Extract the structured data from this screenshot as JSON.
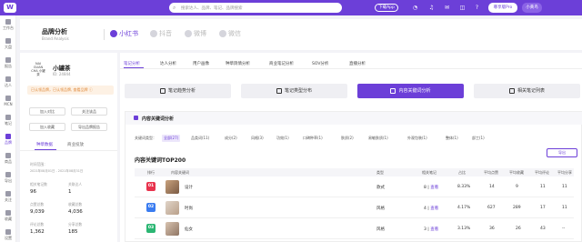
{
  "topbar": {
    "logo": "W",
    "search_placeholder": "搜索达人、品牌、笔记、品牌搜索",
    "download_app": "下载App",
    "buy_pro": "尊享版Pro",
    "user": "小黄鸟"
  },
  "sidebar": {
    "items": [
      {
        "label": "工作台"
      },
      {
        "label": "大盘"
      },
      {
        "label": "报告"
      },
      {
        "label": "达人"
      },
      {
        "label": "MCN"
      },
      {
        "label": "笔记"
      },
      {
        "label": "品牌"
      },
      {
        "label": "商品"
      },
      {
        "label": "导出"
      },
      {
        "label": "关注"
      },
      {
        "label": "收藏"
      },
      {
        "label": "设置"
      }
    ]
  },
  "header": {
    "title": "品牌分析",
    "subtitle": "Brand Analysis",
    "platforms": [
      {
        "label": "小红书",
        "active": true
      },
      {
        "label": "抖音"
      },
      {
        "label": "微博"
      },
      {
        "label": "微信"
      }
    ]
  },
  "brand": {
    "logo_text": "NAI GUAN CHA 小罐茶",
    "name": "小罐茶",
    "id": "ID: 24844",
    "notice": "已认领品牌，已认领品牌,  查看品牌 ⓘ",
    "buttons": {
      "add_compare": "加入对比",
      "follow": "关注该品",
      "add_collection": "加入收藏",
      "report": "导出品牌报告"
    },
    "tabs": [
      "种草数据",
      "商业投放"
    ],
    "time_label": "时间范围：",
    "time_value": "2021年08月01日 - 2021年08月31日",
    "stats": [
      {
        "label": "相关笔记数",
        "value": "96"
      },
      {
        "label": "关联达人",
        "value": "1"
      },
      {
        "label": "点赞总数",
        "value": "9,039"
      },
      {
        "label": "收藏总数",
        "value": "4,036"
      },
      {
        "label": "评论总数",
        "value": "1,362"
      },
      {
        "label": "分享总数",
        "value": "185"
      }
    ]
  },
  "main": {
    "subtabs": [
      "笔记分析",
      "达人分析",
      "用户画像",
      "种草舆情分析",
      "商业笔记分析",
      "SOV分析",
      "直播分析"
    ],
    "big_buttons": [
      "笔记趋势分析",
      "笔记类型分布",
      "内容关键词分析",
      "相关笔记列表"
    ],
    "section_title": "内容关键词分析",
    "filter_label": "关键词类型：",
    "filters": [
      "全部(27)",
      "品类词(11)",
      "成分(2)",
      "风格(3)",
      "功效(1)",
      "口碑种草(1)",
      "肤质(2)",
      "易敏肤质(1)",
      "外观包装(1)",
      "整体(1)",
      "部工(1)"
    ],
    "export": "导出",
    "table_title": "内容关键词TOP200",
    "columns": [
      "排行",
      "内容关键词",
      "类型",
      "相关笔记",
      "占比",
      "平均点赞",
      "平均收藏",
      "平均评论",
      "平均分享"
    ],
    "rows": [
      {
        "rank": "01",
        "keyword": "设计",
        "type": "款式",
        "notes": "8",
        "view": "查看",
        "ratio": "8.33%",
        "likes": "14",
        "collects": "9",
        "comments": "11",
        "shares": "11"
      },
      {
        "rank": "02",
        "keyword": "时尚",
        "type": "风格",
        "notes": "4",
        "view": "查看",
        "ratio": "4.17%",
        "likes": "627",
        "collects": "289",
        "comments": "17",
        "shares": "11"
      },
      {
        "rank": "03",
        "keyword": "仙女",
        "type": "风格",
        "notes": "3",
        "view": "查看",
        "ratio": "3.13%",
        "likes": "36",
        "collects": "26",
        "comments": "43",
        "shares": "--"
      }
    ]
  },
  "colors": {
    "primary": "#6c3fd8",
    "rank1": "#e8334d",
    "rank2": "#3a7cf0",
    "rank3": "#2bb673"
  }
}
